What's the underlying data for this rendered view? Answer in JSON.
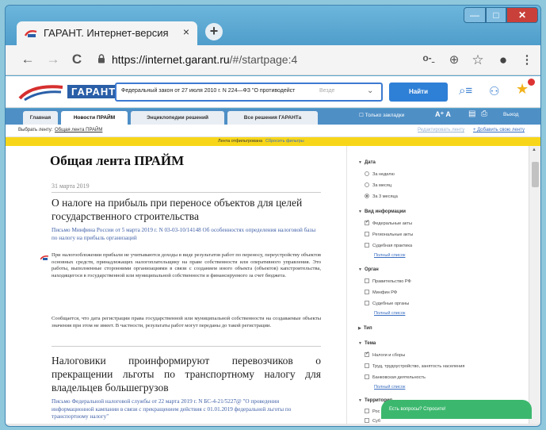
{
  "browser": {
    "tab_title": "ГАРАНТ. Интернет-версия",
    "tab_close": "×",
    "new_tab": "+",
    "url_host": "https://internet.garant.ru",
    "url_path": "/#/startpage:4",
    "win_min": "—",
    "win_max": "□",
    "win_close": "✕",
    "nav_back": "←",
    "nav_forward": "→",
    "nav_reload": "C",
    "key_icon": "o-ˍ",
    "zoom_icon": "⊕",
    "bookmark_icon": "☆",
    "account_icon": "●",
    "menu_icon": "⋮"
  },
  "site": {
    "logo_text": "ГАРАНТ",
    "search_value": "Федеральный закон от 27 июля 2010 г. N 224—ФЗ \"О противодейст",
    "search_placeholder": "Везде",
    "search_dropdown": "⌄",
    "find_button": "Найти",
    "filter_icon": "⌕≡",
    "users_icon": "⚇",
    "star_icon": "★"
  },
  "navtabs": [
    {
      "label": "Главная"
    },
    {
      "label": "Новости ПРАЙМ"
    },
    {
      "label": "Энциклопедии решений"
    },
    {
      "label": "Все решения ГАРАНТа"
    }
  ],
  "navright": {
    "bookmarks_only": "☐ Только закладки",
    "font_size": "A⁺ A",
    "save_icon": "▤",
    "print_icon": "⎙",
    "exit": "Выход"
  },
  "feedrow": {
    "label": "Выбрать ленту:",
    "selected": "Общая лента ПРАЙМ",
    "edit_link": "Редактировать ленту",
    "add_link": "+ Добавить свою ленту"
  },
  "filterbar": {
    "status": "Лента отфильтрована",
    "reset": "Сбросить фильтры"
  },
  "content": {
    "title": "Общая лента ПРАЙМ",
    "date": "31 марта 2019",
    "item1": {
      "headline": "О налоге на прибыль при переносе объектов для целей государственного строительства",
      "doc": "Письмо Минфина России от 5 марта 2019 г. N 03-03-10/14148 Об особенностях определения налоговой базы по налогу на прибыль организаций",
      "para1": "При налогообложении прибыли не учитываются доходы в виде результатов работ по переносу, переустройству объектов основных средств, принадлежащих налогоплательщику на праве собственности или оперативного управления. Это работы, выполненные сторонними организациями в связи с созданием иного объекта (объектов) капстроительства, находящегося в государственной или муниципальной собственности и финансируемого за счет бюджета.",
      "para2": "Сообщается, что дата регистрации права государственной или муниципальной собственности на создаваемые объекты значения при этом не имеет. В частности, результаты работ могут переданы до такой регистрации."
    },
    "item2": {
      "headline": "Налоговики проинформируют перевозчиков о прекращении льготы по транспортному налогу для владельцев большегрузов",
      "doc": "Письмо Федеральной налоговой службы от 22 марта 2019 г. N БС-4-21/5227@ \"О проведении информационной кампании в связи с прекращением действия с 01.01.2019 федеральной льготы по транспортному налогу\""
    }
  },
  "sidebar": {
    "date_h": "Дата",
    "date_opts": [
      "За неделю",
      "За месяц",
      "За 3 месяца"
    ],
    "info_h": "Вид информации",
    "info_opts": [
      "Федеральные акты",
      "Региональные акты",
      "Судебная практика"
    ],
    "full_list": "Полный список",
    "organ_h": "Орган",
    "organ_opts": [
      "Правительство РФ",
      "Минфин РФ",
      "Судебные органы"
    ],
    "type_h": "Тип",
    "theme_h": "Тема",
    "theme_opts": [
      "Налоги и сборы",
      "Труд, трудоустройство, занятость населения",
      "Банковская деятельность"
    ],
    "terr_h": "Территория",
    "terr_opts": [
      "Рос",
      "Суб"
    ]
  },
  "chat": "Есть вопросы? Спросите!"
}
